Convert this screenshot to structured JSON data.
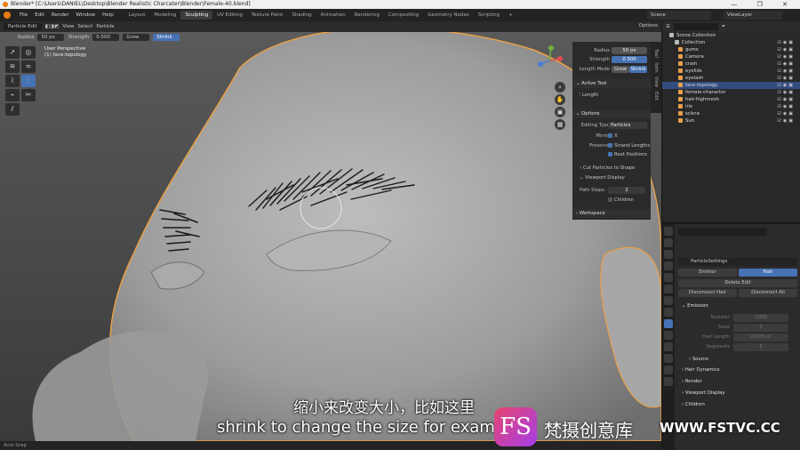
{
  "window": {
    "title": "Blender* [C:\\Users\\DANIEL\\Desktop\\Blender Realistic Charcater\\Blender\\Female-40.blend]",
    "controls": "— ❐ ✕"
  },
  "menu": [
    "File",
    "Edit",
    "Render",
    "Window",
    "Help"
  ],
  "workspaces": [
    "Layout",
    "Modeling",
    "Sculpting",
    "UV Editing",
    "Texture Paint",
    "Shading",
    "Animation",
    "Rendering",
    "Compositing",
    "Geometry Nodes",
    "Scripting",
    "+"
  ],
  "active_workspace": "Sculpting",
  "scene": "Scene",
  "view_layer": "ViewLayer",
  "header": {
    "mode": "Particle Edit",
    "view": "View",
    "select": "Select",
    "particle": "Particle",
    "options": "Options"
  },
  "brush_header": {
    "radius_label": "Radius",
    "radius_value": "50 px",
    "strength_label": "Strength",
    "strength_value": "0.500",
    "grow": "Grow",
    "shrink": "Shrink"
  },
  "viewport": {
    "perspective": "User Perspective",
    "object": "(1) face-topology"
  },
  "npanel": {
    "tabs": [
      "Tool",
      "Item",
      "View",
      "Edit"
    ],
    "radius_label": "Radius",
    "radius_value": "50 px",
    "strength_label": "Strength",
    "strength_value": "0.500",
    "length_mode_label": "Length Mode",
    "grow": "Grow",
    "shrink": "Shrink",
    "active_tool": "Active Tool",
    "active_tool_name": "Length",
    "options": "Options",
    "editing_type_label": "Editing Type",
    "editing_type_value": "Particles",
    "mirror_label": "Mirror",
    "mirror_x": "X",
    "preserve_label": "Preserve",
    "strand_lengths": "Strand Lengths",
    "root_positions": "Root Positions",
    "cut_particles": "Cut Particles to Shape",
    "viewport_display": "Viewport Display",
    "path_steps_label": "Path Steps",
    "path_steps_value": "2",
    "children": "Children",
    "workspace": "Workspace"
  },
  "outliner": {
    "root": "Scene Collection",
    "items": [
      {
        "name": "Collection",
        "kind": "col"
      },
      {
        "name": "gums",
        "kind": "obj"
      },
      {
        "name": "Camera",
        "kind": "obj"
      },
      {
        "name": "crain",
        "kind": "obj"
      },
      {
        "name": "eyelids",
        "kind": "obj"
      },
      {
        "name": "eyelash",
        "kind": "obj"
      },
      {
        "name": "face-topology",
        "kind": "obj",
        "selected": true
      },
      {
        "name": "female-character",
        "kind": "obj"
      },
      {
        "name": "hair-highmesh",
        "kind": "obj"
      },
      {
        "name": "iris",
        "kind": "obj"
      },
      {
        "name": "sclera",
        "kind": "obj"
      },
      {
        "name": "Sun",
        "kind": "obj"
      }
    ]
  },
  "properties": {
    "settings_name": "ParticleSettings",
    "emitter": "Emitter",
    "hair": "Hair",
    "delete_edit": "Delete Edit",
    "disconnect_hair": "Disconnect Hair",
    "disconnect_all": "Disconnect All",
    "emission": "Emission",
    "number_label": "Number",
    "number_value": "1000",
    "seed_label": "Seed",
    "seed_value": "0",
    "hair_length_label": "Hair Length",
    "hair_length_value": "0.003 m",
    "segments_label": "Segments",
    "segments_value": "5",
    "source": "Source",
    "hair_dynamics": "Hair Dynamics",
    "render": "Render",
    "viewport_display": "Viewport Display",
    "children": "Children"
  },
  "status": "Auto Snap",
  "subtitle": {
    "zh": "缩小来改变大小，比如这里",
    "en": "shrink to change the size for exam"
  },
  "watermark": {
    "logo": "FS",
    "cn": "梵摄创意库",
    "url": "WWW.FSTVC.CC"
  },
  "colors": {
    "accent": "#4772b3",
    "selection_outline": "#e8a04a",
    "blender_orange": "#e87d0d"
  }
}
